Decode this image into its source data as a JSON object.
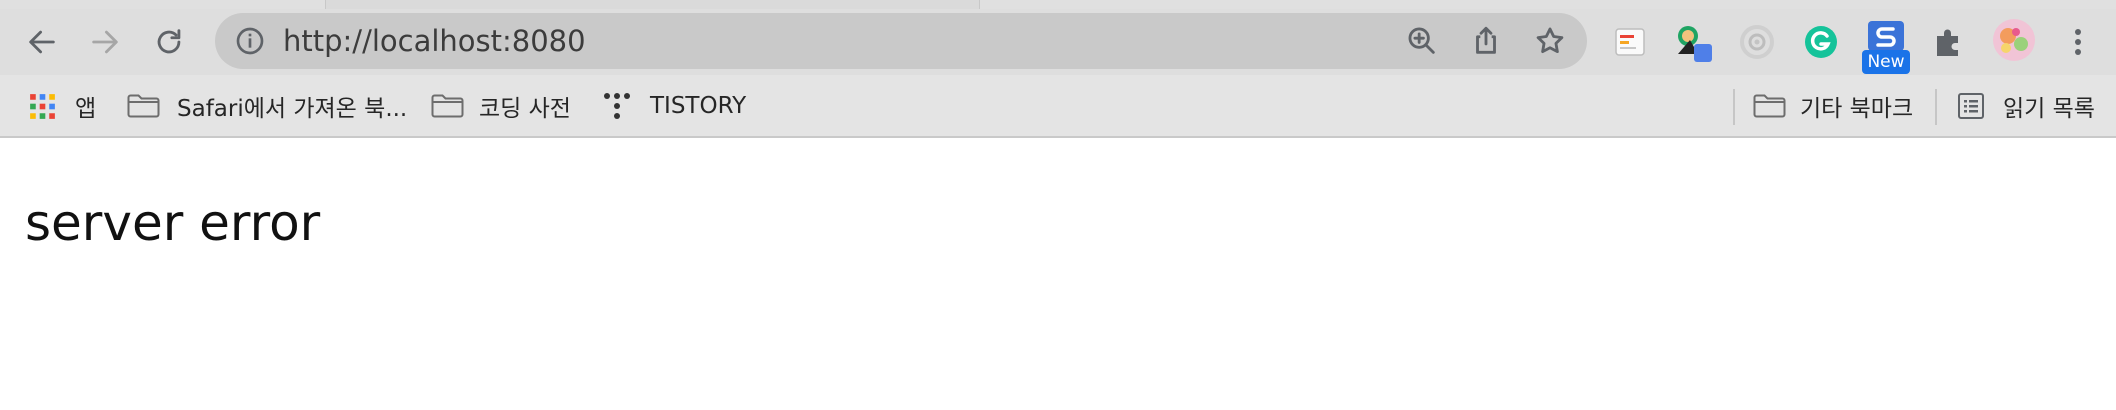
{
  "address_bar": {
    "url": "http://localhost:8080"
  },
  "toolbar": {
    "new_badge": "New",
    "colors": {
      "grammarly": "#15c39a",
      "new_badge": "#1a73e8"
    }
  },
  "bookmarks": {
    "apps_label": "앱",
    "items": [
      {
        "label": "Safari에서 가져온 북..."
      },
      {
        "label": "코딩 사전"
      },
      {
        "label": "TISTORY"
      }
    ],
    "other_label": "기타 북마크",
    "reading_list_label": "읽기 목록"
  },
  "page": {
    "message": "server error"
  }
}
